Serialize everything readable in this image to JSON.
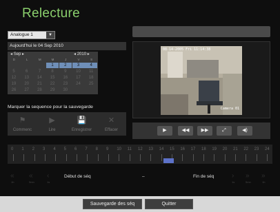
{
  "title": "Relecture",
  "channel": {
    "selected": "Analogue 1"
  },
  "today_text": "Aujourd'hui le 04 Sep 2010",
  "calendar": {
    "month": "Sep",
    "year": "2010",
    "weekdays": [
      "D",
      "L",
      "M",
      "M",
      "J",
      "V",
      "S"
    ],
    "rows": [
      [
        "",
        "",
        "",
        "1",
        "2",
        "3",
        "4"
      ],
      [
        "5",
        "6",
        "7",
        "8",
        "9",
        "10",
        "11"
      ],
      [
        "12",
        "13",
        "14",
        "15",
        "16",
        "17",
        "18"
      ],
      [
        "19",
        "20",
        "21",
        "22",
        "23",
        "24",
        "25"
      ],
      [
        "26",
        "27",
        "28",
        "29",
        "30",
        "",
        ""
      ]
    ],
    "recorded_days": [
      "1",
      "2",
      "3",
      "4"
    ]
  },
  "sequence_title": "Marquer la sequence pour la sauvegarde",
  "actions": [
    {
      "icon": "flag-icon",
      "glyph": "⚑",
      "label": "Commenc"
    },
    {
      "icon": "play-icon",
      "glyph": "▶",
      "label": "Lire"
    },
    {
      "icon": "save-icon",
      "glyph": "💾",
      "label": "Enregistrer"
    },
    {
      "icon": "delete-icon",
      "glyph": "✕",
      "label": "Effacer"
    }
  ],
  "video": {
    "timestamp": "08-14-2005 Fri 11:14:38",
    "camera": "Camera 01"
  },
  "controls": [
    {
      "icon": "play-icon",
      "glyph": "▶"
    },
    {
      "icon": "rewind-icon",
      "glyph": "◀◀"
    },
    {
      "icon": "fast-forward-icon",
      "glyph": "▶▶"
    },
    {
      "icon": "fullscreen-icon",
      "glyph": "⤢"
    },
    {
      "icon": "volume-icon",
      "glyph": "◀)"
    }
  ],
  "timeline": {
    "hours": [
      "0",
      "1",
      "2",
      "3",
      "4",
      "5",
      "6",
      "7",
      "8",
      "9",
      "10",
      "11",
      "12",
      "13",
      "14",
      "15",
      "16",
      "17",
      "18",
      "19",
      "20",
      "21",
      "22",
      "23",
      "24"
    ],
    "marker_hour": 14.2
  },
  "seq": {
    "start_label": "Début de séq",
    "dash": "–",
    "end_label": "Fin de séq",
    "left_step_labels": [
      "1h",
      "5mn",
      "1s"
    ],
    "right_step_labels": [
      "1s",
      "5mn",
      "1h"
    ]
  },
  "buttons": {
    "save": "Sauvegarde des séq",
    "quit": "Quitter"
  }
}
